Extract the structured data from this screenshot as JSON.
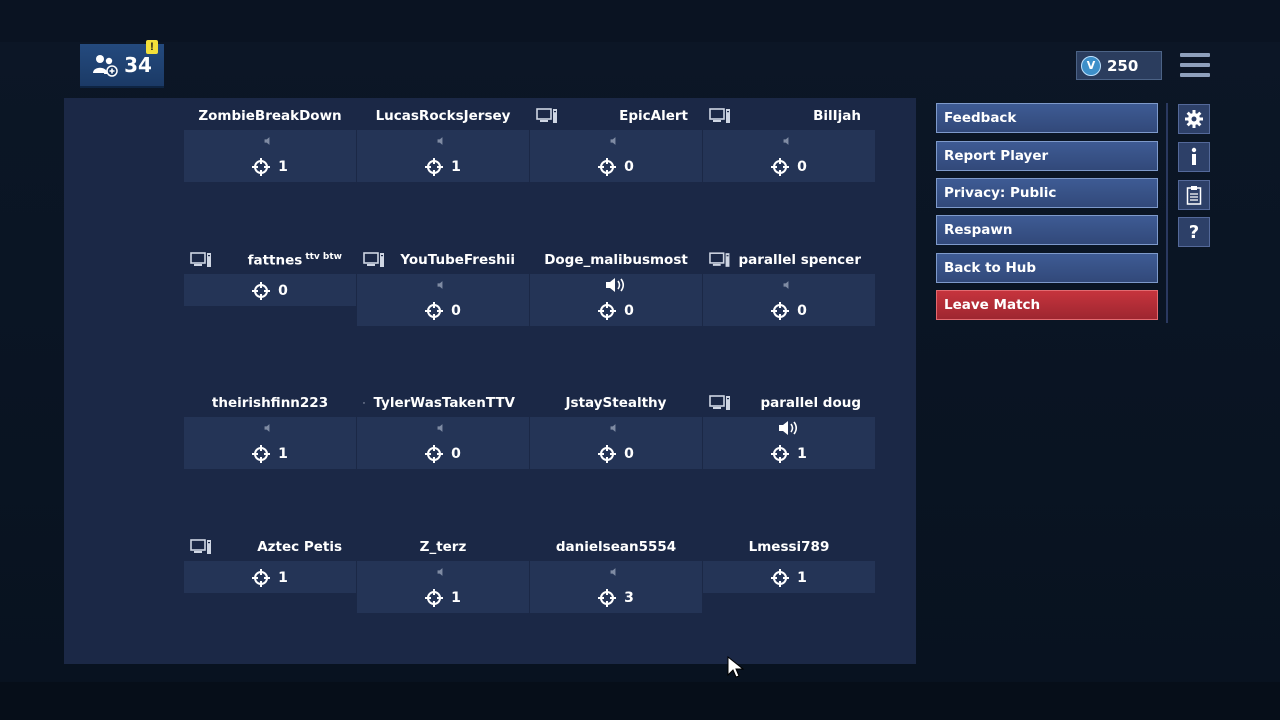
{
  "header": {
    "party_count": "34",
    "notification": "!",
    "vbucks": "250"
  },
  "players": [
    {
      "name": "ZombieBreakDown",
      "kills": "1",
      "speaker": "muted",
      "platform": "none"
    },
    {
      "name": "LucasRocksJersey",
      "kills": "1",
      "speaker": "muted",
      "platform": "none"
    },
    {
      "name": "EpicAlert",
      "kills": "0",
      "speaker": "muted",
      "platform": "pc"
    },
    {
      "name": "BilIjah",
      "kills": "0",
      "speaker": "muted",
      "platform": "pc"
    },
    {
      "name": "fattnes",
      "tag": "ttv btw",
      "kills": "0",
      "speaker": "none",
      "platform": "pc"
    },
    {
      "name": "YouTubeFreshii",
      "kills": "0",
      "speaker": "muted",
      "platform": "pc"
    },
    {
      "name": "Doge_malibusmost",
      "kills": "0",
      "speaker": "active",
      "platform": "none"
    },
    {
      "name": "parallel spencer",
      "kills": "0",
      "speaker": "muted",
      "platform": "pc"
    },
    {
      "name": "theirishfinn223",
      "kills": "1",
      "speaker": "muted",
      "platform": "none"
    },
    {
      "name": "TylerWasTakenTTV",
      "kills": "0",
      "speaker": "muted",
      "platform": "pc"
    },
    {
      "name": "JstayStealthy",
      "kills": "0",
      "speaker": "muted",
      "platform": "none"
    },
    {
      "name": "parallel doug",
      "kills": "1",
      "speaker": "active",
      "platform": "pc"
    },
    {
      "name": "Aztec Petis",
      "kills": "1",
      "speaker": "none",
      "platform": "pc"
    },
    {
      "name": "Z_terz",
      "kills": "1",
      "speaker": "muted",
      "platform": "none"
    },
    {
      "name": "danielsean5554",
      "kills": "3",
      "speaker": "muted",
      "platform": "none"
    },
    {
      "name": "Lmessi789",
      "kills": "1",
      "speaker": "none",
      "platform": "none"
    }
  ],
  "menu": {
    "feedback": "Feedback",
    "report_player": "Report Player",
    "privacy": "Privacy: Public",
    "respawn": "Respawn",
    "back_to_hub": "Back to Hub",
    "leave_match": "Leave Match"
  },
  "icons": {
    "settings": "gear-icon",
    "info": "info-icon",
    "clipboard": "clipboard-icon",
    "help": "help-icon"
  },
  "colors": {
    "accent_button": "#3e5b94",
    "danger_button": "#c6343d",
    "panel": "#1b2846"
  }
}
